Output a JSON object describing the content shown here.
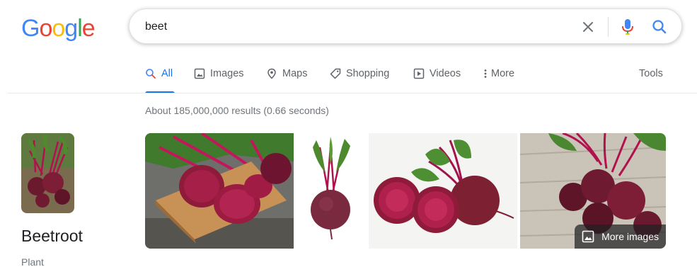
{
  "logo": {
    "text": "Google",
    "letters": [
      {
        "ch": "G",
        "color": "#4285F4"
      },
      {
        "ch": "o",
        "color": "#EA4335"
      },
      {
        "ch": "o",
        "color": "#FBBC05"
      },
      {
        "ch": "g",
        "color": "#4285F4"
      },
      {
        "ch": "l",
        "color": "#34A853"
      },
      {
        "ch": "e",
        "color": "#EA4335"
      }
    ]
  },
  "search": {
    "value": "beet"
  },
  "tabs": [
    {
      "label": "All",
      "icon": "search-icon",
      "active": true
    },
    {
      "label": "Images",
      "icon": "image-icon",
      "active": false
    },
    {
      "label": "Maps",
      "icon": "map-pin-icon",
      "active": false
    },
    {
      "label": "Shopping",
      "icon": "tag-icon",
      "active": false
    },
    {
      "label": "Videos",
      "icon": "play-icon",
      "active": false
    },
    {
      "label": "More",
      "icon": "more-vert-icon",
      "active": false
    }
  ],
  "tools_label": "Tools",
  "result_stats": "About 185,000,000 results (0.66 seconds)",
  "knowledge_panel": {
    "title": "Beetroot",
    "subtitle": "Plant"
  },
  "images": {
    "more_label": "More images"
  },
  "colors": {
    "accent": "#1a73e8",
    "beet": "#8e1b3a",
    "beet_dark": "#5a0f25",
    "leaf": "#3e8e3a",
    "stem": "#c2185b"
  }
}
